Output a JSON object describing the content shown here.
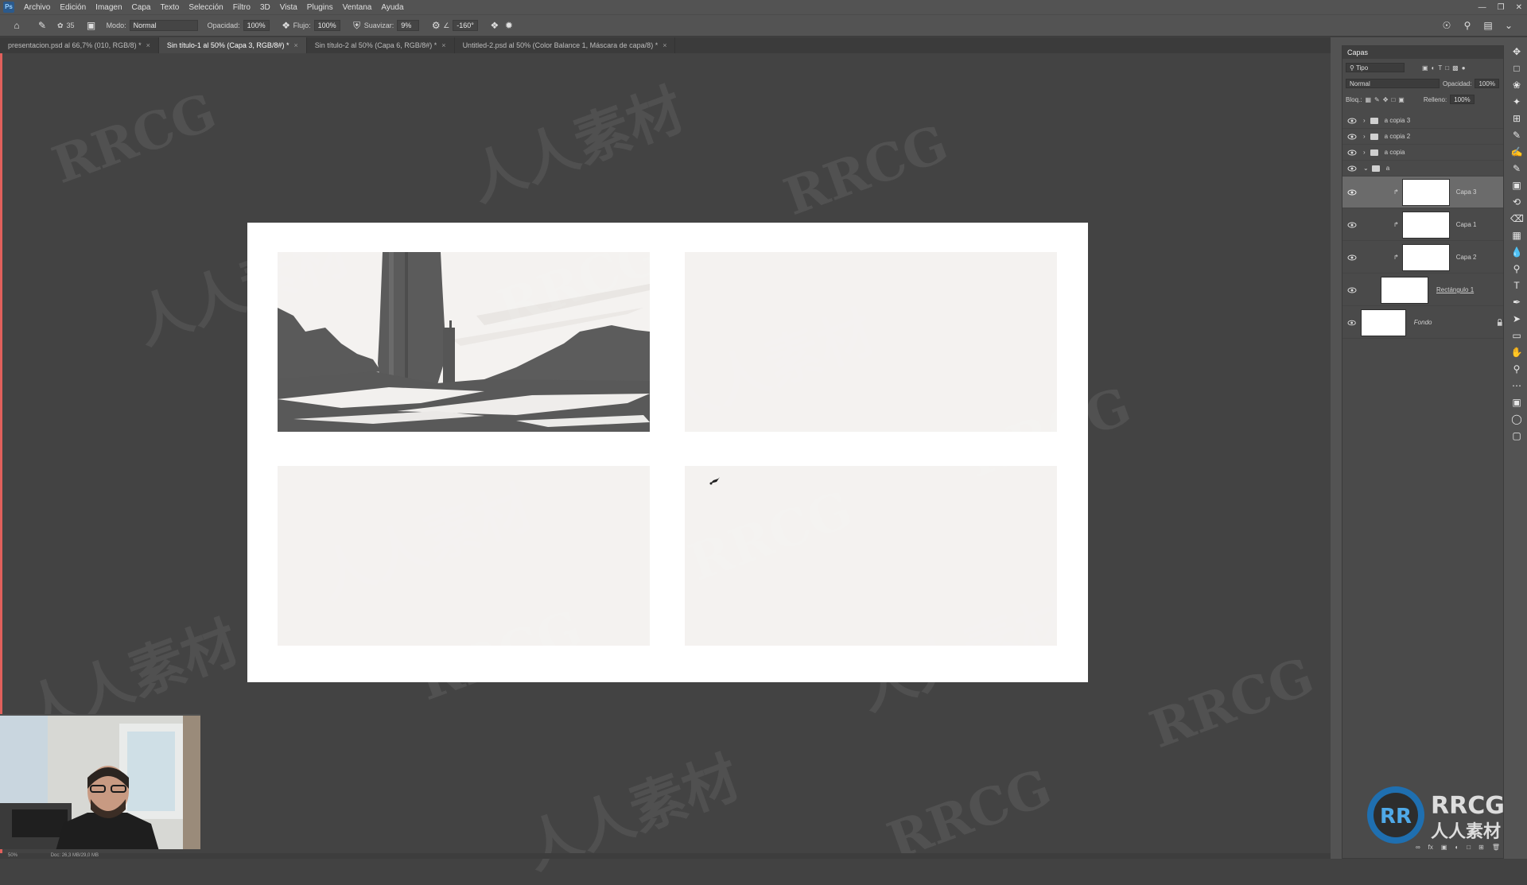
{
  "menu": {
    "app_icon": "Ps",
    "items": [
      "Archivo",
      "Edición",
      "Imagen",
      "Capa",
      "Texto",
      "Selección",
      "Filtro",
      "3D",
      "Vista",
      "Plugins",
      "Ventana",
      "Ayuda"
    ]
  },
  "options": {
    "brush_size": "35",
    "mode_label": "Modo:",
    "mode_value": "Normal",
    "opacity_label": "Opacidad:",
    "opacity_value": "100%",
    "flow_label": "Flujo:",
    "flow_value": "100%",
    "smoothing_label": "Suavizar:",
    "smoothing_value": "9%",
    "angle_value": "-160°"
  },
  "tabs": [
    {
      "label": "presentacion.psd al 66,7% (010, RGB/8) *",
      "active": false
    },
    {
      "label": "Sin título-1 al 50% (Capa 3, RGB/8#) *",
      "active": true
    },
    {
      "label": "Sin título-2 al 50% (Capa 6, RGB/8#) *",
      "active": false
    },
    {
      "label": "Untitled-2.psd al 50% (Color Balance 1, Máscara de capa/8) *",
      "active": false
    }
  ],
  "layers_panel": {
    "title": "Capas",
    "filter_label": "Tipo",
    "blend_mode": "Normal",
    "opacity_label": "Opacidad:",
    "opacity_value": "100%",
    "lock_label": "Bloq.:",
    "fill_label": "Relleno:",
    "fill_value": "100%",
    "layers": [
      {
        "name": "a copia 3",
        "type": "group"
      },
      {
        "name": "a copia 2",
        "type": "group"
      },
      {
        "name": "a copia",
        "type": "group"
      },
      {
        "name": "a",
        "type": "group-open"
      },
      {
        "name": "Capa 3",
        "type": "layer",
        "selected": true
      },
      {
        "name": "Capa 1",
        "type": "layer"
      },
      {
        "name": "Capa 2",
        "type": "layer"
      },
      {
        "name": "Rectángulo 1",
        "type": "shape"
      },
      {
        "name": "Fondo",
        "type": "background"
      }
    ]
  },
  "status": {
    "zoom": "50%",
    "doc": "Doc: 26,3 MB/29,0 MB"
  },
  "watermark": {
    "latin": "RRCG",
    "chinese": "人人素材"
  },
  "colors": {
    "accent": "#e1605c",
    "canvas_bg": "#434343",
    "frame_fill": "#f4f2f0",
    "ink": "#555555"
  }
}
